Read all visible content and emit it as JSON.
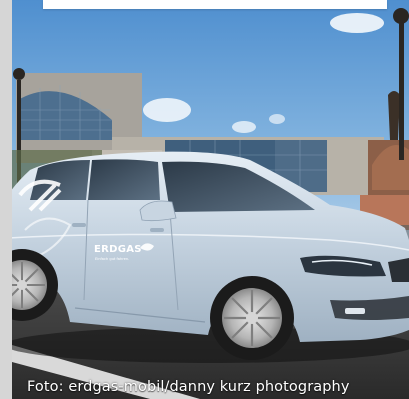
{
  "caption": {
    "credit": "Foto: erdgas-mobil/danny kurz photography"
  },
  "car_decal": {
    "brand": "ERDGAS",
    "tagline": "Einfach gut fahren."
  },
  "colors": {
    "sky": "#6fa6d8",
    "car_body": "#c9d6e2",
    "road": "#3c3c3c",
    "building_glass": "#5a7fa0"
  }
}
